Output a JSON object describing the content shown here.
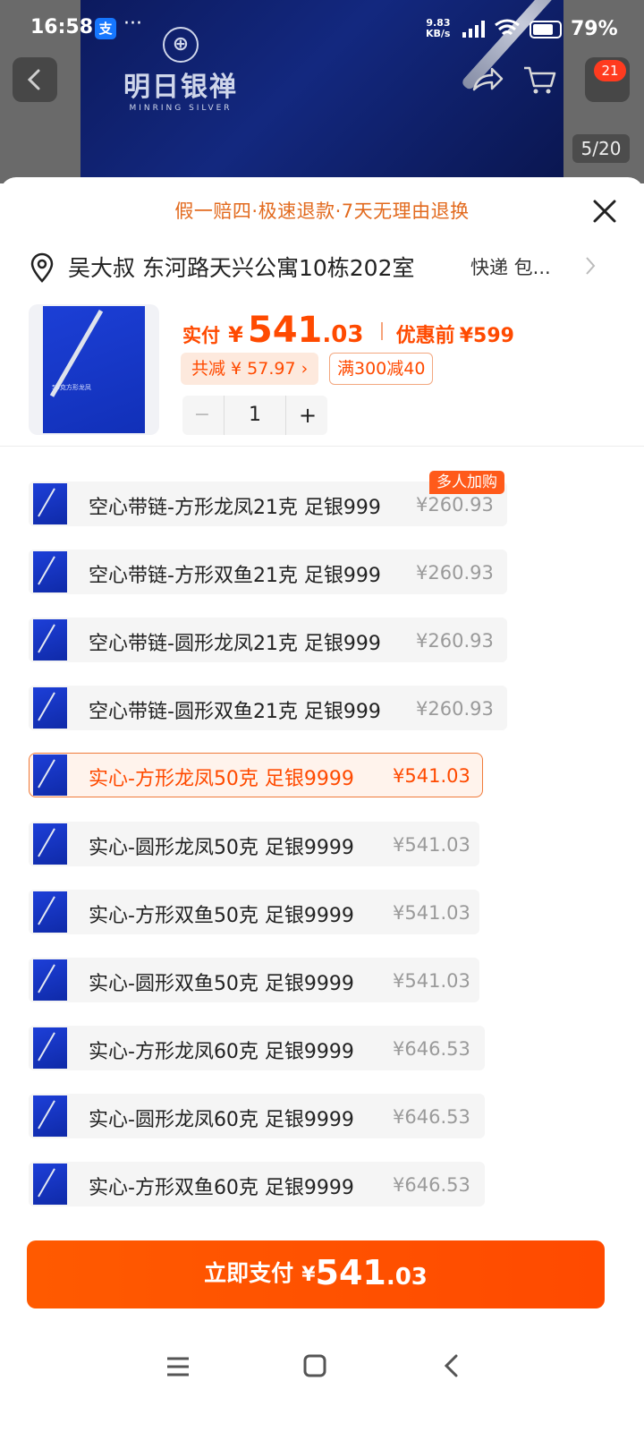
{
  "status_bar": {
    "time": "16:58",
    "alipay_icon": "支",
    "dots": "···",
    "net_speed_value": "9.83",
    "net_speed_unit": "KB/s",
    "battery_percent": "79%",
    "battery_level": 0.79
  },
  "hero": {
    "brand_cn": "明日银禅",
    "brand_en": "MINRING SILVER",
    "cart_badge": "21",
    "image_counter": "5/20"
  },
  "sheet": {
    "guarantee": "假一赔四·极速退款·7天无理由退换",
    "address": "吴大叔 东河路天兴公寓10栋202室",
    "shipping": "快递 包...",
    "product_thumb_text": "50克方形龙凤",
    "price": {
      "label": "实付",
      "currency": "¥",
      "integer": "541",
      "decimal": ".03",
      "before_label": "优惠前",
      "before_value": "¥599"
    },
    "discount_chip": "共减 ¥ 57.97 ›",
    "promo_chip": "满300减40",
    "quantity": {
      "minus": "−",
      "value": "1",
      "plus": "+"
    },
    "hot_tag": "多人加购"
  },
  "options": [
    {
      "label": "空心带链-方形龙凤21克 足银999",
      "price": "¥260.93",
      "selected": false
    },
    {
      "label": "空心带链-方形双鱼21克 足银999",
      "price": "¥260.93",
      "selected": false
    },
    {
      "label": "空心带链-圆形龙凤21克 足银999",
      "price": "¥260.93",
      "selected": false
    },
    {
      "label": "空心带链-圆形双鱼21克 足银999",
      "price": "¥260.93",
      "selected": false
    },
    {
      "label": "实心-方形龙凤50克 足银9999",
      "price": "¥541.03",
      "selected": true
    },
    {
      "label": "实心-圆形龙凤50克 足银9999",
      "price": "¥541.03",
      "selected": false
    },
    {
      "label": "实心-方形双鱼50克 足银9999",
      "price": "¥541.03",
      "selected": false
    },
    {
      "label": "实心-圆形双鱼50克 足银9999",
      "price": "¥541.03",
      "selected": false
    },
    {
      "label": "实心-方形龙凤60克 足银9999",
      "price": "¥646.53",
      "selected": false
    },
    {
      "label": "实心-圆形龙凤60克 足银9999",
      "price": "¥646.53",
      "selected": false
    },
    {
      "label": "实心-方形双鱼60克 足银9999",
      "price": "¥646.53",
      "selected": false
    }
  ],
  "pay_button": {
    "label": "立即支付",
    "currency": "¥",
    "integer": "541",
    "decimal": ".03"
  },
  "icons": {
    "back": "chevron-left-icon",
    "share": "share-icon",
    "cart": "cart-icon",
    "close": "close-icon",
    "location": "location-pin-icon",
    "chevron": "chevron-right-icon",
    "nav_menu": "menu-icon",
    "nav_home": "home-square-icon",
    "nav_back": "back-icon"
  },
  "colors": {
    "accent": "#ff4a00",
    "guarantee_text": "#e26a1e",
    "chip_bg": "#fde9dd",
    "option_bg": "#f5f5f5",
    "selected_border": "#f07a3a",
    "product_blue": "#1c3fd6"
  }
}
